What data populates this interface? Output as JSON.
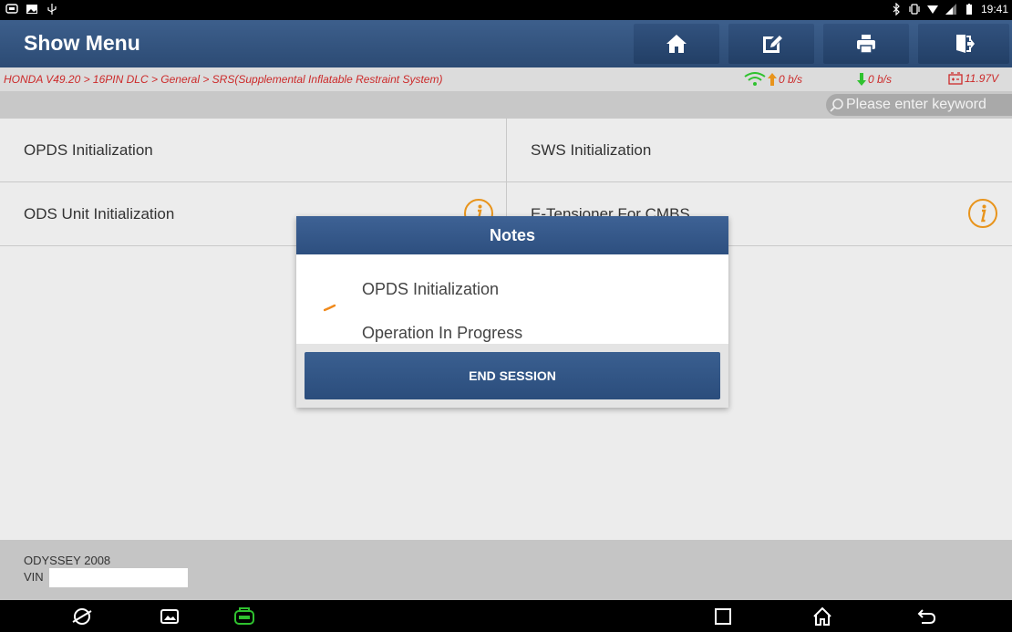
{
  "status_bar": {
    "time": "19:41"
  },
  "header": {
    "title": "Show Menu",
    "buttons": [
      {
        "icon": "home-icon"
      },
      {
        "icon": "edit-icon"
      },
      {
        "icon": "print-icon"
      },
      {
        "icon": "exit-icon"
      }
    ]
  },
  "breadcrumb": {
    "path": "HONDA V49.20 > 16PIN DLC > General > SRS(Supplemental Inflatable Restraint System)",
    "upload_rate": "0 b/s",
    "download_rate": "0 b/s",
    "voltage": "11.97V"
  },
  "search": {
    "placeholder": "Please enter keyword"
  },
  "menu": {
    "items": [
      {
        "label": "OPDS Initialization",
        "has_info": false
      },
      {
        "label": "SWS Initialization",
        "has_info": false
      },
      {
        "label": "ODS Unit Initialization",
        "has_info": true
      },
      {
        "label": "E-Tensioner For CMBS",
        "has_info": true
      }
    ]
  },
  "footer": {
    "model": "ODYSSEY 2008",
    "vin_label": "VIN"
  },
  "dialog": {
    "title": "Notes",
    "line1": "OPDS Initialization",
    "line2": "Operation In Progress",
    "button_label": "END SESSION"
  },
  "colors": {
    "header": "#2c4b74",
    "breadcrumb_text": "#cc2a2a",
    "signal_green": "#2fc22f",
    "info_orange": "#e8941c",
    "spinner_orange": "#f08a1c"
  }
}
